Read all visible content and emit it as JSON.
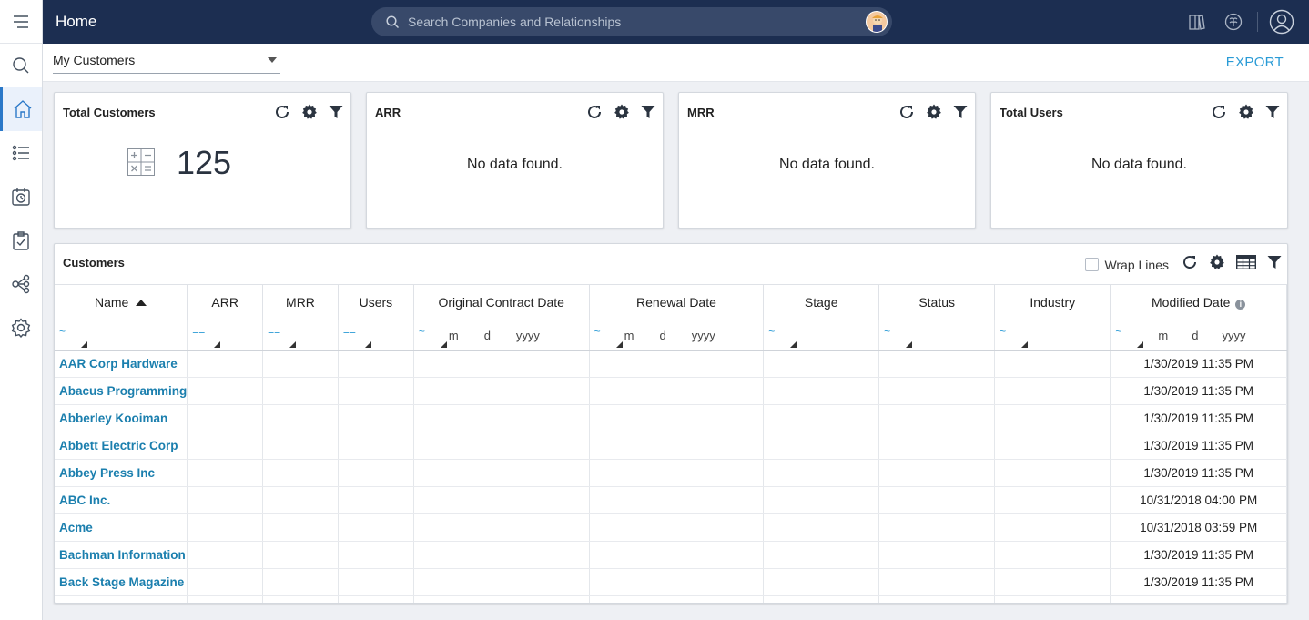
{
  "topbar": {
    "title": "Home",
    "search_placeholder": "Search Companies and Relationships"
  },
  "subbar": {
    "view_selected": "My Customers",
    "export_label": "EXPORT"
  },
  "widgets": [
    {
      "title": "Total Customers",
      "value": "125"
    },
    {
      "title": "ARR",
      "message": "No data found."
    },
    {
      "title": "MRR",
      "message": "No data found."
    },
    {
      "title": "Total Users",
      "message": "No data found."
    }
  ],
  "customers_panel": {
    "title": "Customers",
    "wrap_lines_label": "Wrap Lines",
    "columns": [
      "Name",
      "ARR",
      "MRR",
      "Users",
      "Original Contract Date",
      "Renewal Date",
      "Stage",
      "Status",
      "Industry",
      "Modified Date"
    ],
    "filter_ops": {
      "name": "~",
      "arr": "==",
      "mrr": "==",
      "users": "==",
      "original_contract_date": "~",
      "renewal_date": "~",
      "stage": "~",
      "status": "~",
      "industry": "~",
      "modified_date": "~"
    },
    "date_placeholders": {
      "m": "m",
      "d": "d",
      "yyyy": "yyyy"
    },
    "rows": [
      {
        "name": "AAR Corp Hardware",
        "modified": "1/30/2019 11:35 PM"
      },
      {
        "name": "Abacus Programming",
        "modified": "1/30/2019 11:35 PM"
      },
      {
        "name": "Abberley Kooiman",
        "modified": "1/30/2019 11:35 PM"
      },
      {
        "name": "Abbett Electric Corp",
        "modified": "1/30/2019 11:35 PM"
      },
      {
        "name": "Abbey Press Inc",
        "modified": "1/30/2019 11:35 PM"
      },
      {
        "name": "ABC Inc.",
        "modified": "10/31/2018 04:00 PM"
      },
      {
        "name": "Acme",
        "modified": "10/31/2018 03:59 PM"
      },
      {
        "name": "Bachman Information",
        "modified": "1/30/2019 11:35 PM"
      },
      {
        "name": "Back Stage Magazine",
        "modified": "1/30/2019 11:35 PM"
      }
    ]
  },
  "colors": {
    "topbar_bg": "#1c2e51",
    "accent": "#2a9bd6",
    "link": "#1b7fae"
  }
}
